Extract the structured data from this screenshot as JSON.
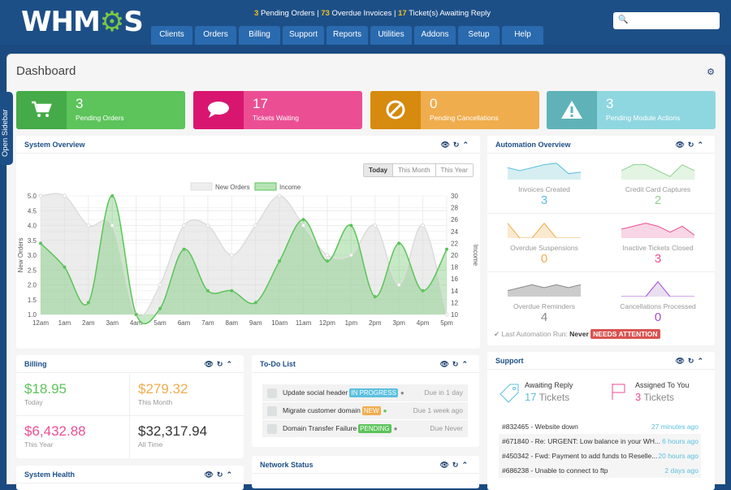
{
  "header": {
    "logo": {
      "left": "WHM",
      "gear": "⚙",
      "right": "S"
    },
    "stats": [
      {
        "count": "3",
        "label": "Pending Orders"
      },
      {
        "count": "73",
        "label": "Overdue Invoices"
      },
      {
        "count": "17",
        "label": "Ticket(s) Awaiting Reply"
      }
    ],
    "nav": [
      "Clients",
      "Orders",
      "Billing",
      "Support",
      "Reports",
      "Utilities",
      "Addons",
      "Setup",
      "Help"
    ],
    "search": {
      "placeholder": "",
      "icon": "search-icon"
    }
  },
  "page": {
    "title": "Dashboard",
    "open_sidebar_label": "Open Sidebar"
  },
  "stat_boxes": [
    {
      "value": "3",
      "label": "Pending Orders",
      "icon": "cart-icon",
      "color": "#5cc45a",
      "icon_bg": "#45aa48"
    },
    {
      "value": "17",
      "label": "Tickets Waiting",
      "icon": "comment-icon",
      "color": "#ec4e93",
      "icon_bg": "#d9166f"
    },
    {
      "value": "0",
      "label": "Pending Cancellations",
      "icon": "ban-icon",
      "color": "#f0ad4e",
      "icon_bg": "#d68a0e"
    },
    {
      "value": "3",
      "label": "Pending Module Actions",
      "icon": "warning-icon",
      "color": "#8fd7e0",
      "icon_bg": "#5fb3b8"
    }
  ],
  "system_overview": {
    "title": "System Overview",
    "range_buttons": [
      "Today",
      "This Month",
      "This Year"
    ],
    "active_range": "Today"
  },
  "chart_data": {
    "type": "line",
    "title": "",
    "x": [
      "12am",
      "1am",
      "2am",
      "3am",
      "4am",
      "5am",
      "6am",
      "7am",
      "8am",
      "9am",
      "10am",
      "11am",
      "12pm",
      "1pm",
      "2pm",
      "3pm",
      "4pm",
      "5pm"
    ],
    "series": [
      {
        "name": "New Orders",
        "axis": "left",
        "color": "#dcdcdc",
        "values": [
          5.0,
          5.0,
          4.0,
          4.0,
          1.0,
          2.0,
          4.0,
          4.0,
          3.0,
          4.0,
          5.0,
          4.0,
          3.0,
          3.0,
          4.0,
          2.0,
          4.0,
          1.0
        ]
      },
      {
        "name": "Income",
        "axis": "right",
        "color": "#5cc45a",
        "values": [
          22,
          18,
          12,
          30,
          10,
          11,
          21,
          14,
          14,
          12,
          19,
          26,
          19,
          25,
          13,
          22,
          14,
          21
        ]
      }
    ],
    "ylabel": "New Orders",
    "y2label": "Income",
    "ylim": [
      1.0,
      5.0
    ],
    "y2lim": [
      10,
      30
    ],
    "yticks": [
      "5.0",
      "4.5",
      "4.0",
      "3.5",
      "3.0",
      "2.5",
      "2.0",
      "1.5",
      "1.0"
    ],
    "y2ticks": [
      "30",
      "28",
      "26",
      "24",
      "22",
      "20",
      "18",
      "16",
      "14",
      "12",
      "10"
    ],
    "legend": "top-center",
    "grid": true
  },
  "automation": {
    "title": "Automation Overview",
    "items": [
      {
        "label": "Invoices Created",
        "value": "3",
        "color": "#5bc0de",
        "fill": "#d6eef1",
        "spark": [
          4,
          3,
          4,
          5,
          5.5,
          2,
          2.5
        ]
      },
      {
        "label": "Credit Card Captures",
        "value": "2",
        "color": "#8fd08f",
        "fill": "#e3f4e3",
        "spark": [
          3,
          5,
          5,
          3,
          1,
          5,
          3
        ]
      },
      {
        "label": "Overdue Suspensions",
        "value": "0",
        "color": "#f0ad4e",
        "fill": "#fbe9cf",
        "spark": [
          5,
          0,
          0,
          5,
          0,
          0,
          0
        ]
      },
      {
        "label": "Inactive Tickets Closed",
        "value": "3",
        "color": "#ec4e93",
        "fill": "#f8d6e5",
        "spark": [
          3,
          4,
          5,
          4,
          2,
          4,
          1
        ]
      },
      {
        "label": "Overdue Reminders",
        "value": "4",
        "color": "#888888",
        "fill": "#cccccc",
        "spark": [
          2,
          3,
          4,
          3,
          4,
          3,
          4
        ]
      },
      {
        "label": "Cancellations Processed",
        "value": "0",
        "color": "#a64bd6",
        "fill": "#e9dff0",
        "spark": [
          0,
          0,
          0,
          5,
          0,
          0,
          0
        ]
      }
    ],
    "last_run_label": "Last Automation Run:",
    "last_run_value": "Never",
    "attention_badge": "NEEDS ATTENTION"
  },
  "billing": {
    "title": "Billing",
    "cells": [
      {
        "amount": "$18.95",
        "label": "Today",
        "color": "#5cc45a"
      },
      {
        "amount": "$279.32",
        "label": "This Month",
        "color": "#f0ad4e"
      },
      {
        "amount": "$6,432.88",
        "label": "This Year",
        "color": "#ec4e93"
      },
      {
        "amount": "$32,317.94",
        "label": "All Time",
        "color": "#333333"
      }
    ]
  },
  "todo": {
    "title": "To-Do List",
    "items": [
      {
        "text": "Update social header",
        "badge": "IN PROGRESS",
        "badge_color": "#5bc0de",
        "user_color": "#888888",
        "due": "Due in 1 day"
      },
      {
        "text": "Migrate customer domain",
        "badge": "NEW",
        "badge_color": "#f0ad4e",
        "user_color": "#5cc45a",
        "due": "Due 1 week ago"
      },
      {
        "text": "Domain Transfer Failure",
        "badge": "PENDING",
        "badge_color": "#5cc45a",
        "user_color": "#888888",
        "due": "Due Never"
      }
    ]
  },
  "support": {
    "title": "Support",
    "awaiting": {
      "label": "Awaiting Reply",
      "count": "17",
      "unit": "Tickets"
    },
    "assigned": {
      "label": "Assigned To You",
      "count": "3",
      "unit": "Tickets"
    },
    "tickets": [
      {
        "subject": "#832465 - Website down",
        "time": "27 minutes ago"
      },
      {
        "subject": "#671840 - Re: URGENT: Low balance in your WH...",
        "time": "6 hours ago"
      },
      {
        "subject": "#450342 - Fwd: Payment to add funds to Reselle...",
        "time": "20 hours ago"
      },
      {
        "subject": "#686238 - Unable to connect to ftp",
        "time": "2 days ago"
      }
    ]
  },
  "system_health": {
    "title": "System Health"
  },
  "network_status": {
    "title": "Network Status"
  }
}
